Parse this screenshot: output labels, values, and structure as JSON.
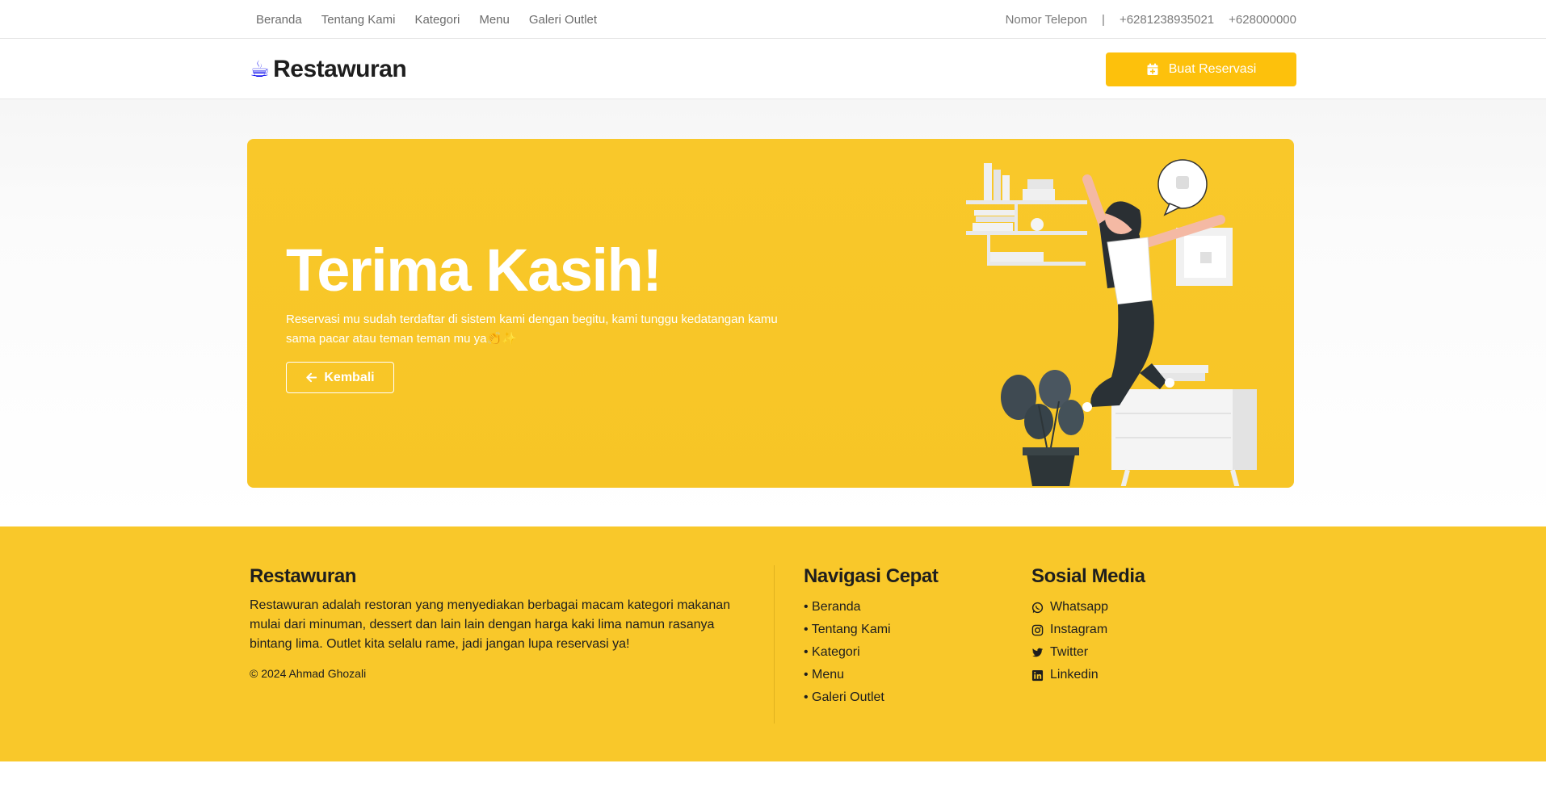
{
  "topbar": {
    "nav": [
      "Beranda",
      "Tentang Kami",
      "Kategori",
      "Menu",
      "Galeri Outlet"
    ],
    "phone_label": "Nomor Telepon",
    "separator": "|",
    "phone_1": "+6281238935021",
    "phone_2": "+628000000"
  },
  "header": {
    "brand_icon": "☕",
    "brand_name": "Restawuran",
    "reserve_button": "Buat Reservasi",
    "reserve_icon": "calendar-plus-icon"
  },
  "hero": {
    "title": "Terima Kasih!",
    "text": "Reservasi mu sudah terdaftar di sistem kami dengan begitu, kami tunggu kedatangan kamu sama pacar atau teman teman mu ya👏✨",
    "back_button": "Kembali",
    "back_icon": "arrow-left-icon"
  },
  "footer": {
    "about_title": "Restawuran",
    "about_text": "Restawuran adalah restoran yang menyediakan berbagai macam kategori makanan mulai dari minuman, dessert dan lain lain dengan harga kaki lima namun rasanya bintang lima. Outlet kita selalu rame, jadi jangan lupa reservasi ya!",
    "copyright": "© 2024 Ahmad Ghozali",
    "nav_title": "Navigasi Cepat",
    "nav_items": [
      "• Beranda",
      "• Tentang Kami",
      "• Kategori",
      "• Menu",
      "• Galeri Outlet"
    ],
    "social_title": "Sosial Media",
    "social_items": [
      {
        "label": "Whatsapp",
        "icon": "whatsapp-icon"
      },
      {
        "label": "Instagram",
        "icon": "instagram-icon"
      },
      {
        "label": "Twitter",
        "icon": "twitter-icon"
      },
      {
        "label": "Linkedin",
        "icon": "linkedin-icon"
      }
    ]
  },
  "colors": {
    "accent": "#fdc10c",
    "hero_bg": "#f9c82a",
    "footer_bg": "#f9c82a",
    "text_dark": "#1e1e1e"
  }
}
